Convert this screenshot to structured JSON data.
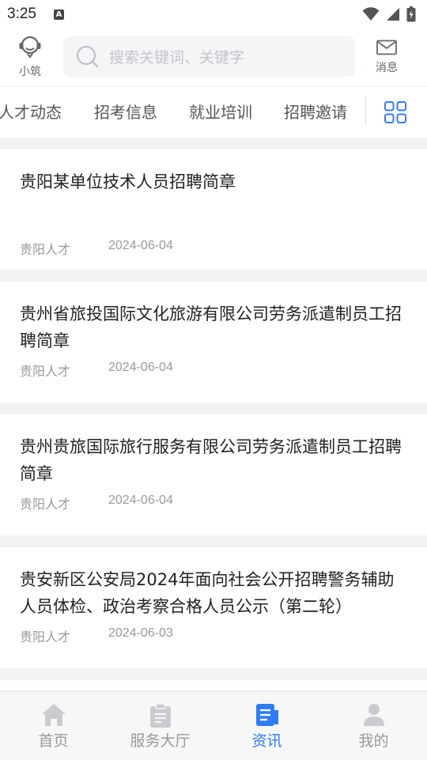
{
  "status_bar": {
    "time": "3:25",
    "notification_badge": "A"
  },
  "header": {
    "assistant_label": "小筑",
    "search": {
      "placeholder": "搜索关键词、关键字"
    },
    "message_label": "消息"
  },
  "tabs": [
    {
      "label": "人才动态"
    },
    {
      "label": "招考信息"
    },
    {
      "label": "就业培训"
    },
    {
      "label": "招聘邀请"
    }
  ],
  "articles": [
    {
      "title": "贵阳某单位技术人员招聘简章",
      "source": "贵阳人才",
      "date": "2024-06-04"
    },
    {
      "title": "贵州省旅投国际文化旅游有限公司劳务派遣制员工招聘简章",
      "source": "贵阳人才",
      "date": "2024-06-04"
    },
    {
      "title": "贵州贵旅国际旅行服务有限公司劳务派遣制员工招聘简章",
      "source": "贵阳人才",
      "date": "2024-06-04"
    },
    {
      "title": "贵安新区公安局2024年面向社会公开招聘警务辅助人员体检、政治考察合格人员公示（第二轮）",
      "source": "贵阳人才",
      "date": "2024-06-03"
    }
  ],
  "bottom_nav": [
    {
      "label": "首页",
      "icon": "home-icon"
    },
    {
      "label": "服务大厅",
      "icon": "clipboard-icon"
    },
    {
      "label": "资讯",
      "icon": "news-icon",
      "active": true
    },
    {
      "label": "我的",
      "icon": "user-icon"
    }
  ],
  "colors": {
    "accent": "#2f7cf6",
    "muted_icon": "#c9cbcf",
    "background": "#f1f2f4"
  }
}
